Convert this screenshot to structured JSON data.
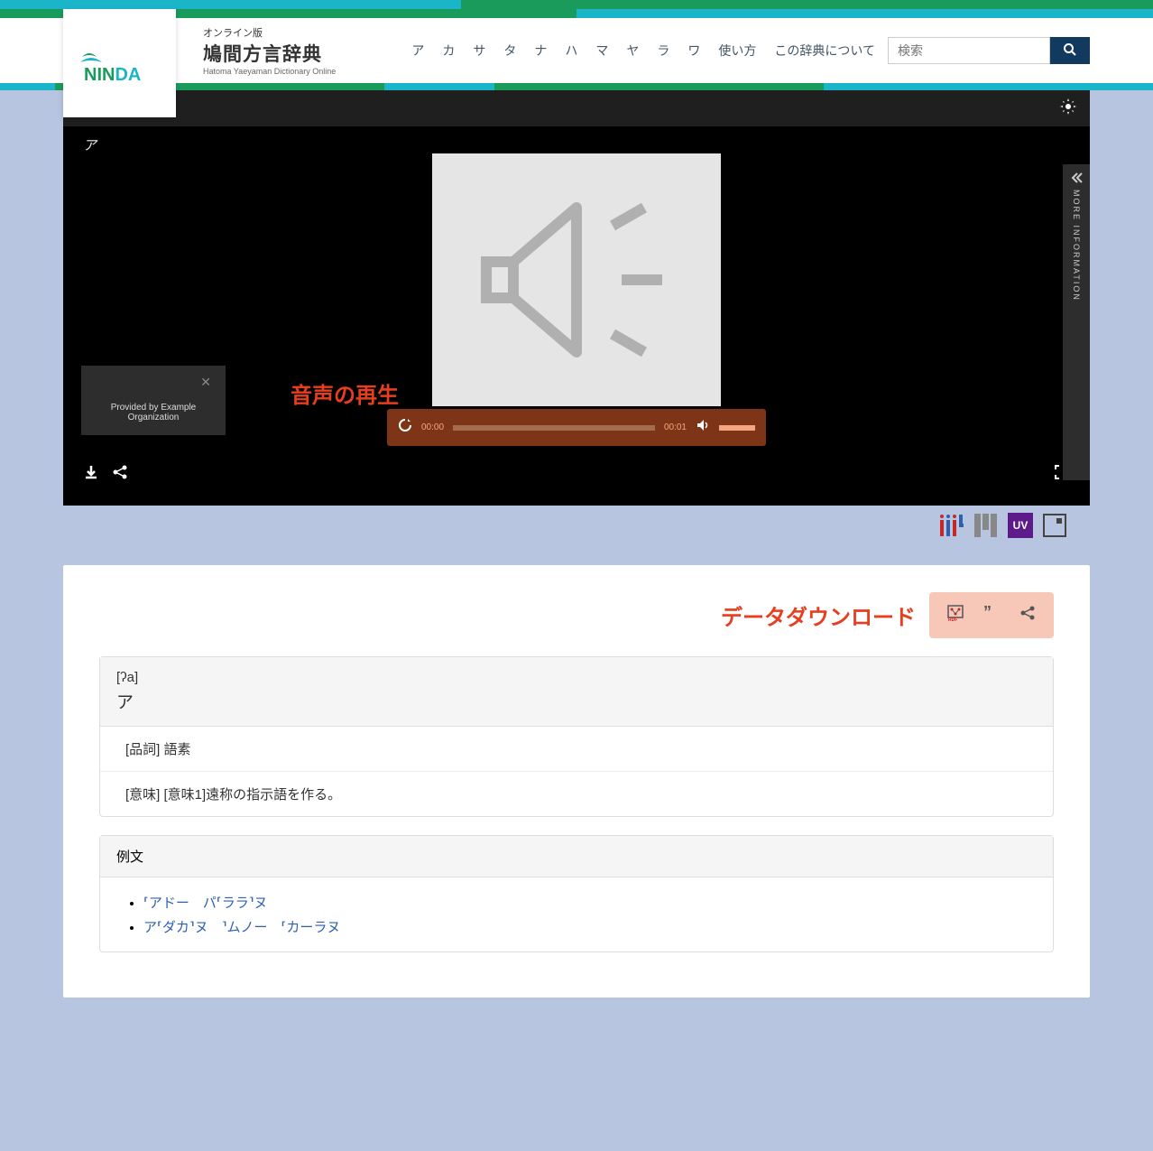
{
  "header": {
    "logo_text": "NINDA",
    "title_sub": "オンライン版",
    "title_main": "鳩間方言辞典",
    "title_en": "Hatoma Yaeyaman Dictionary Online"
  },
  "nav": {
    "items": [
      "ア",
      "カ",
      "サ",
      "タ",
      "ナ",
      "ハ",
      "マ",
      "ヤ",
      "ラ",
      "ワ",
      "使い方",
      "この辞典について"
    ],
    "search_placeholder": "検索"
  },
  "viewer": {
    "label": "ア",
    "more_info": "MORE INFORMATION",
    "attribution": "Provided by Example Organization",
    "audio_annotation": "音声の再生",
    "audio_current": "00:00",
    "audio_total": "00:01"
  },
  "icon_row": {
    "uv_label": "UV"
  },
  "download": {
    "label": "データダウンロード"
  },
  "entry": {
    "ipa": "[ʔa]",
    "kana": "ア",
    "pos": "[品詞] 語素",
    "meaning": "[意味] [意味1]遠称の指示語を作る。"
  },
  "examples": {
    "header": "例文",
    "items": [
      "⸢アドー　パ⸢ララ⸣ヌ",
      "ア⸢ダカ⸣ヌ　⸣ムノー　⸢カーラヌ"
    ]
  }
}
